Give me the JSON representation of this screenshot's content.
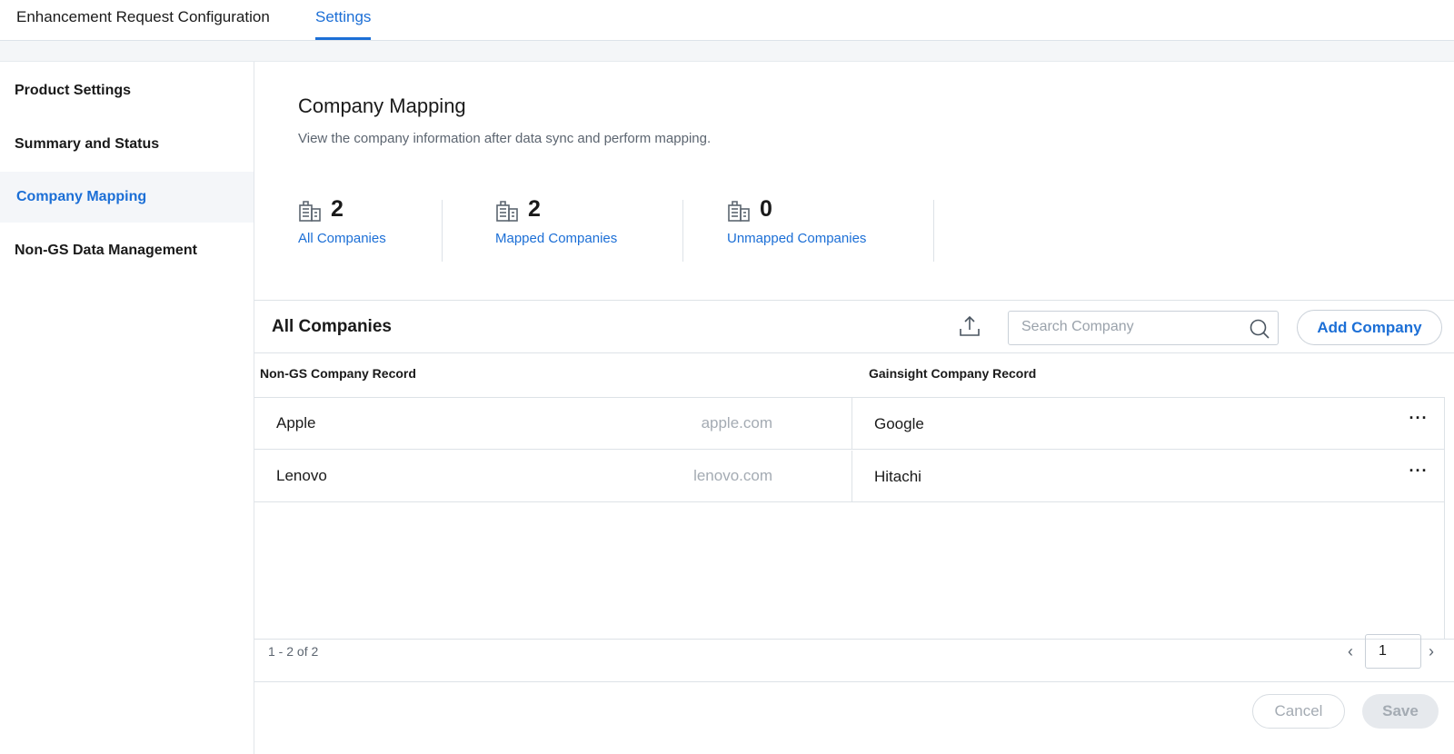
{
  "tabs": [
    {
      "label": "Enhancement Request Configuration",
      "active": false
    },
    {
      "label": "Settings",
      "active": true
    }
  ],
  "sidebar": {
    "items": [
      {
        "label": "Product Settings"
      },
      {
        "label": "Summary and Status"
      },
      {
        "label": "Company Mapping",
        "active": true
      },
      {
        "label": "Non-GS Data Management"
      }
    ]
  },
  "page": {
    "title": "Company Mapping",
    "description": "View the company information after data sync and perform mapping."
  },
  "stats": [
    {
      "icon": "building-icon",
      "count": "2",
      "label": "All Companies"
    },
    {
      "icon": "building-icon",
      "count": "2",
      "label": "Mapped Companies"
    },
    {
      "icon": "building-icon",
      "count": "0",
      "label": "Unmapped Companies"
    }
  ],
  "table": {
    "title": "All Companies",
    "search_placeholder": "Search Company",
    "add_label": "Add Company",
    "columns": [
      "Non-GS Company Record",
      "Gainsight Company Record"
    ],
    "rows": [
      {
        "name": "Apple",
        "domain": "apple.com",
        "gs_company": "Google",
        "menu": "···"
      },
      {
        "name": "Lenovo",
        "domain": "lenovo.com",
        "gs_company": "Hitachi",
        "menu": "···"
      }
    ]
  },
  "pagination": {
    "range": "1 - 2 of 2",
    "page": "1",
    "prev": "‹",
    "next": "›"
  },
  "footer": {
    "cancel_label": "Cancel",
    "save_label": "Save"
  },
  "colors": {
    "accent": "#1c6fd6",
    "border": "#dde2e7",
    "muted_text": "#5c6570"
  }
}
